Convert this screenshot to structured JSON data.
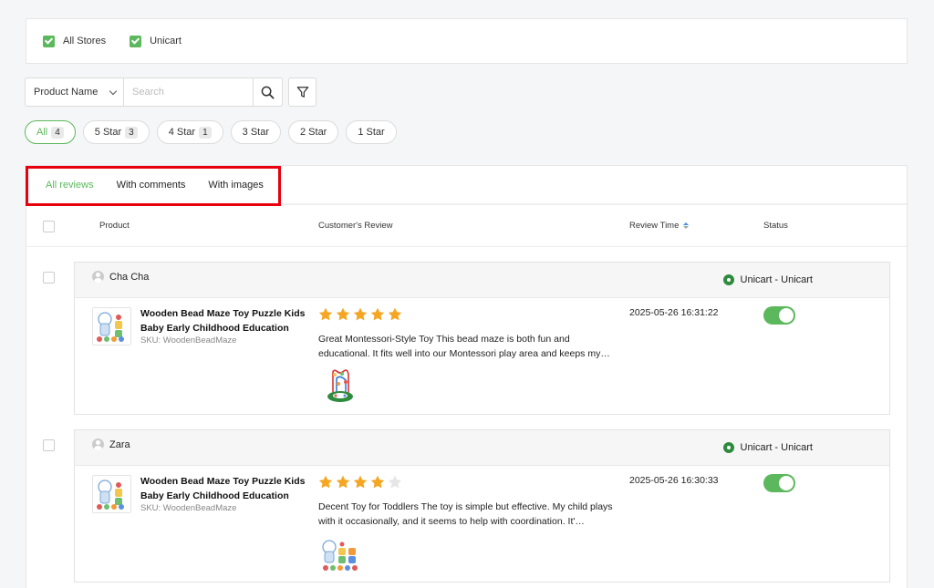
{
  "stores": [
    {
      "label": "All Stores",
      "checked": true
    },
    {
      "label": "Unicart",
      "checked": true
    }
  ],
  "search": {
    "field_select": "Product Name",
    "placeholder": "Search",
    "value": ""
  },
  "star_filters": [
    {
      "label": "All",
      "count": "4",
      "active": true
    },
    {
      "label": "5 Star",
      "count": "3"
    },
    {
      "label": "4 Star",
      "count": "1"
    },
    {
      "label": "3 Star",
      "count": ""
    },
    {
      "label": "2 Star",
      "count": ""
    },
    {
      "label": "1 Star",
      "count": ""
    }
  ],
  "tabs": [
    {
      "label": "All reviews",
      "active": true
    },
    {
      "label": "With comments"
    },
    {
      "label": "With images"
    }
  ],
  "table_headers": {
    "product": "Product",
    "review": "Customer's Review",
    "time": "Review Time",
    "status": "Status"
  },
  "colors": {
    "accent": "#5cb85c",
    "star": "#f5a623",
    "highlight": "#e8000f"
  },
  "reviews": [
    {
      "user": "Cha Cha",
      "store": "Unicart - Unicart",
      "product_name": "Wooden Bead Maze Toy Puzzle Kids Baby Early Childhood Education",
      "sku": "SKU: WoodenBeadMaze",
      "rating": 5,
      "text": "Great Montessori-Style Toy This bead maze is both fun and educational. It fits well into our Montessori play area and keeps my…",
      "image_icon": "bead-maze-image",
      "time": "2025-05-26 16:31:22",
      "status_on": true
    },
    {
      "user": "Zara",
      "store": "Unicart - Unicart",
      "product_name": "Wooden Bead Maze Toy Puzzle Kids Baby Early Childhood Education",
      "sku": "SKU: WoodenBeadMaze",
      "rating": 4,
      "text": "Decent Toy for Toddlers The toy is simple but effective. My child plays with it occasionally, and it seems to help with coordination. It'…",
      "image_icon": "bead-toys-image",
      "time": "2025-05-26 16:30:33",
      "status_on": true
    }
  ]
}
